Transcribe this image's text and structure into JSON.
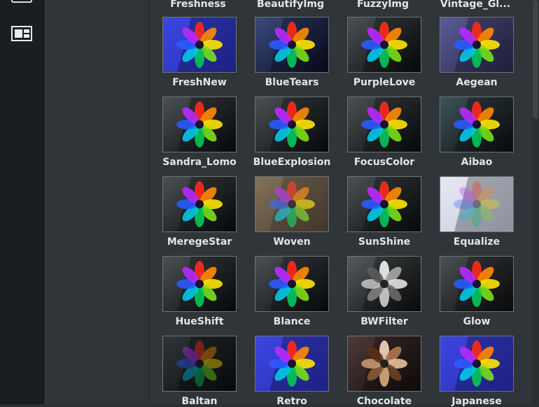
{
  "toolbar": {
    "layout_icon": "layout-grid-icon"
  },
  "top_row_labels": [
    "Freshness",
    "BeautifyImg",
    "FuzzyImg",
    "Vintage_Gl..."
  ],
  "effects": [
    {
      "label": "FreshNew",
      "style": "blue"
    },
    {
      "label": "BlueTears",
      "style": "navy"
    },
    {
      "label": "PurpleLove",
      "style": "dark"
    },
    {
      "label": "Aegean",
      "style": "violet"
    },
    {
      "label": "Sandra_Lomo",
      "style": "dark"
    },
    {
      "label": "BlueExplosion",
      "style": "dark"
    },
    {
      "label": "FocusColor",
      "style": "dark"
    },
    {
      "label": "Aibao",
      "style": "cool"
    },
    {
      "label": "MeregeStar",
      "style": "dark"
    },
    {
      "label": "Woven",
      "style": "woven"
    },
    {
      "label": "SunShine",
      "style": "dark"
    },
    {
      "label": "Equalize",
      "style": "light"
    },
    {
      "label": "HueShift",
      "style": "dark"
    },
    {
      "label": "Blance",
      "style": "dark"
    },
    {
      "label": "BWFilter",
      "style": "bw"
    },
    {
      "label": "Glow",
      "style": "dark"
    },
    {
      "label": "Baltan",
      "style": "faded"
    },
    {
      "label": "Retro",
      "style": "blue"
    },
    {
      "label": "Chocolate",
      "style": "choc"
    },
    {
      "label": "Japanese",
      "style": "blue"
    }
  ]
}
